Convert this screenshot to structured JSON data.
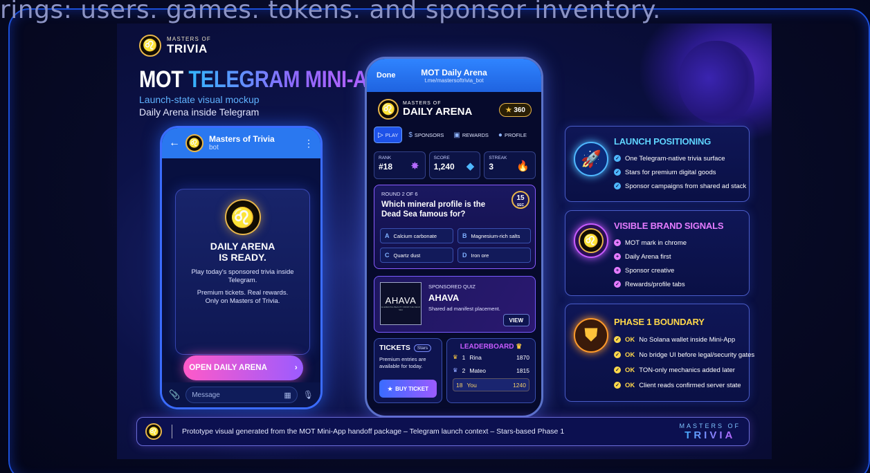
{
  "caption": "rings: users. games. tokens. and sponsor inventory.",
  "brand": {
    "small": "MASTERS OF",
    "large": "TRIVIA"
  },
  "headline": {
    "part1": "MOT",
    "part2": "TELEGRAM MINI-APP"
  },
  "subtitle1": "Launch-state visual mockup",
  "subtitle2": "Daily Arena inside Telegram",
  "phone1": {
    "chat_name": "Masters of Trivia",
    "chat_sub": "bot",
    "card_title_1": "DAILY ARENA",
    "card_title_2": "IS READY.",
    "card_p1": "Play today's sponsored trivia inside Telegram.",
    "card_p2": "Premium tickets. Real rewards. Only on Masters of Trivia.",
    "cta": "OPEN DAILY ARENA",
    "message_placeholder": "Message"
  },
  "phone2": {
    "done": "Done",
    "title": "MOT Daily Arena",
    "url": "t.me/mastersoftrivia_bot",
    "brand_small": "MASTERS OF",
    "brand_large": "DAILY ARENA",
    "stars": "360",
    "nav": [
      "PLAY",
      "SPONSORS",
      "REWARDS",
      "PROFILE"
    ],
    "stats": [
      {
        "label": "RANK",
        "value": "#18"
      },
      {
        "label": "SCORE",
        "value": "1,240"
      },
      {
        "label": "STREAK",
        "value": "3"
      }
    ],
    "quiz": {
      "round": "ROUND 2 OF 6",
      "question": "Which mineral profile is the Dead Sea famous for?",
      "timer": "15",
      "timer_unit": "SEC",
      "options": [
        {
          "key": "A",
          "text": "Calcium carbonate"
        },
        {
          "key": "B",
          "text": "Magnesium-rich salts"
        },
        {
          "key": "C",
          "text": "Quartz dust"
        },
        {
          "key": "D",
          "text": "Iron ore"
        }
      ]
    },
    "sponsor": {
      "label": "SPONSORED QUIZ",
      "name": "AHAVA",
      "logo_text": "AHAVA",
      "logo_tag": "ELEMENTAL BEAUTY FROM THE DEAD SEA",
      "desc": "Shared ad manifest placement.",
      "view": "VIEW"
    },
    "tickets": {
      "title": "TICKETS",
      "badge": "Stars",
      "text": "Premium entries are available for today.",
      "buy": "BUY TICKET"
    },
    "leaderboard": {
      "title": "LEADERBOARD",
      "rows": [
        {
          "rank": "1",
          "name": "Rina",
          "score": "1870"
        },
        {
          "rank": "2",
          "name": "Mateo",
          "score": "1815"
        },
        {
          "rank": "18",
          "name": "You",
          "score": "1240"
        }
      ]
    }
  },
  "panels": [
    {
      "title": "LAUNCH POSITIONING",
      "title_color": "#5fd4ff",
      "items": [
        "One Telegram-native trivia surface",
        "Stars for premium digital goods",
        "Sponsor campaigns from shared ad stack"
      ]
    },
    {
      "title": "VISIBLE BRAND SIGNALS",
      "title_color": "#e47bff",
      "items": [
        "MOT mark in chrome",
        "Daily Arena first",
        "Sponsor creative",
        "Rewards/profile tabs"
      ]
    },
    {
      "title": "PHASE 1 BOUNDARY",
      "title_color": "#ffd84a",
      "ok_label": "OK",
      "items": [
        "No Solana wallet inside Mini-App",
        "No bridge UI before legal/security gates",
        "TON-only mechanics added later",
        "Client reads confirmed server state"
      ]
    }
  ],
  "footer": {
    "text": "Prototype visual generated from the MOT Mini-App handoff package – Telegram launch context – Stars-based Phase 1",
    "mark_small": "MASTERS OF",
    "mark_large": "TRIVIA"
  }
}
